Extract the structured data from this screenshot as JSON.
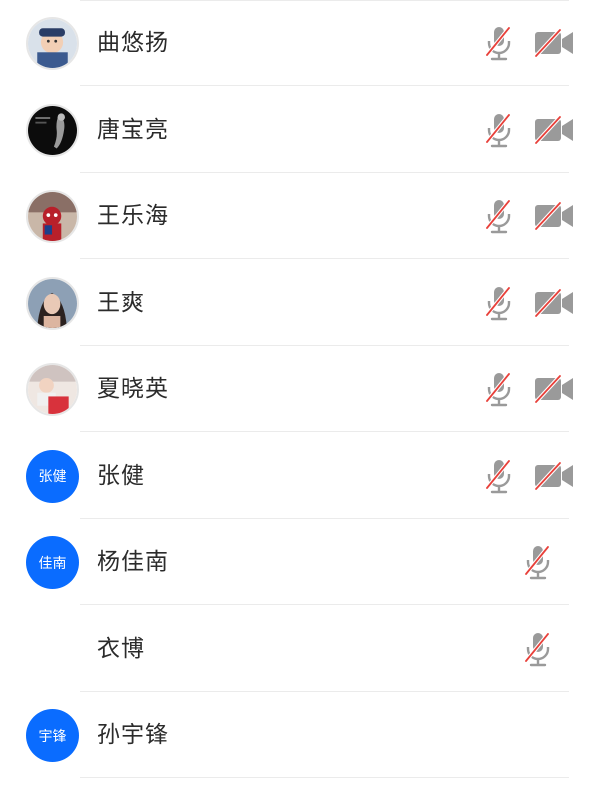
{
  "participants": [
    {
      "name": "曲悠扬",
      "avatar": {
        "type": "photo",
        "theme": "baby-sailor"
      },
      "mic": "muted",
      "camera": "off"
    },
    {
      "name": "唐宝亮",
      "avatar": {
        "type": "photo",
        "theme": "dark"
      },
      "mic": "muted",
      "camera": "off"
    },
    {
      "name": "王乐海",
      "avatar": {
        "type": "photo",
        "theme": "spiderman"
      },
      "mic": "muted",
      "camera": "off"
    },
    {
      "name": "王爽",
      "avatar": {
        "type": "photo",
        "theme": "woman"
      },
      "mic": "muted",
      "camera": "off"
    },
    {
      "name": "夏晓英",
      "avatar": {
        "type": "photo",
        "theme": "child"
      },
      "mic": "muted",
      "camera": "off"
    },
    {
      "name": "张健",
      "avatar": {
        "type": "initials",
        "text": "张健"
      },
      "mic": "muted",
      "camera": "off"
    },
    {
      "name": "杨佳南",
      "avatar": {
        "type": "initials",
        "text": "佳南"
      },
      "mic": "muted",
      "camera": "none"
    },
    {
      "name": "衣博",
      "avatar": {
        "type": "none"
      },
      "mic": "muted",
      "camera": "none"
    },
    {
      "name": "孙宇锋",
      "avatar": {
        "type": "initials",
        "text": "宇锋"
      },
      "mic": "none",
      "camera": "none"
    }
  ],
  "colors": {
    "accent": "#0a6cff",
    "icon_gray": "#9a9a9a",
    "slash_red": "#e8403a",
    "divider": "#ebebeb"
  },
  "icons": {
    "mic": "mic-muted-icon",
    "camera": "camera-off-icon"
  }
}
